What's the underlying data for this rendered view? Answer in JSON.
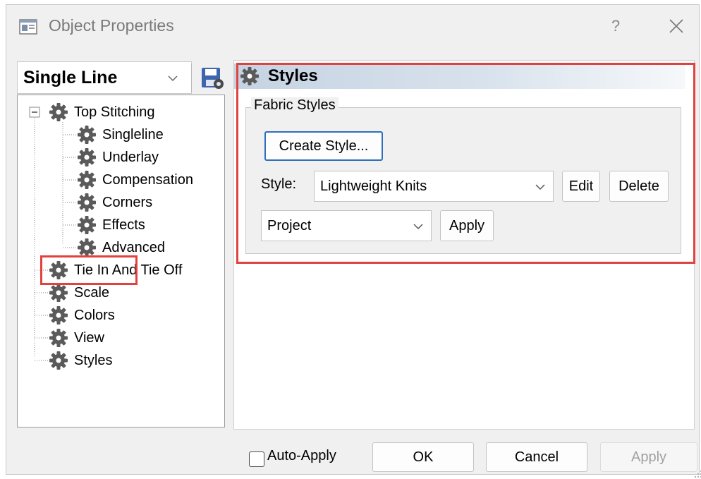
{
  "window": {
    "title": "Object Properties",
    "help_label": "?",
    "app_icon": "dialog-icon",
    "close_icon": "close-icon"
  },
  "object_type": {
    "selected": "Single Line",
    "save_icon": "save-settings-icon"
  },
  "tree": {
    "items": [
      {
        "label": "Top Stitching",
        "level": 0,
        "expanded": true
      },
      {
        "label": "Singleline",
        "level": 1
      },
      {
        "label": "Underlay",
        "level": 1
      },
      {
        "label": "Compensation",
        "level": 1
      },
      {
        "label": "Corners",
        "level": 1
      },
      {
        "label": "Effects",
        "level": 1
      },
      {
        "label": "Advanced",
        "level": 1
      },
      {
        "label": "Tie In And Tie Off",
        "level": 0
      },
      {
        "label": "Scale",
        "level": 0
      },
      {
        "label": "Colors",
        "level": 0
      },
      {
        "label": "View",
        "level": 0
      },
      {
        "label": "Styles",
        "level": 0,
        "selected": true
      }
    ]
  },
  "panel": {
    "title": "Styles",
    "group_title": "Fabric Styles",
    "create_style_label": "Create Style...",
    "style_label": "Style:",
    "style_value": "Lightweight Knits",
    "edit_label": "Edit",
    "delete_label": "Delete",
    "scope_value": "Project",
    "apply_label": "Apply"
  },
  "footer": {
    "auto_apply_label": "Auto-Apply",
    "auto_apply_checked": false,
    "ok_label": "OK",
    "cancel_label": "Cancel",
    "apply_label": "Apply"
  },
  "colors": {
    "highlight": "#e2423f",
    "default_button_border": "#2c6fba",
    "save_icon_blue": "#3d66ad",
    "gear_gray": "#5a5a5a"
  }
}
